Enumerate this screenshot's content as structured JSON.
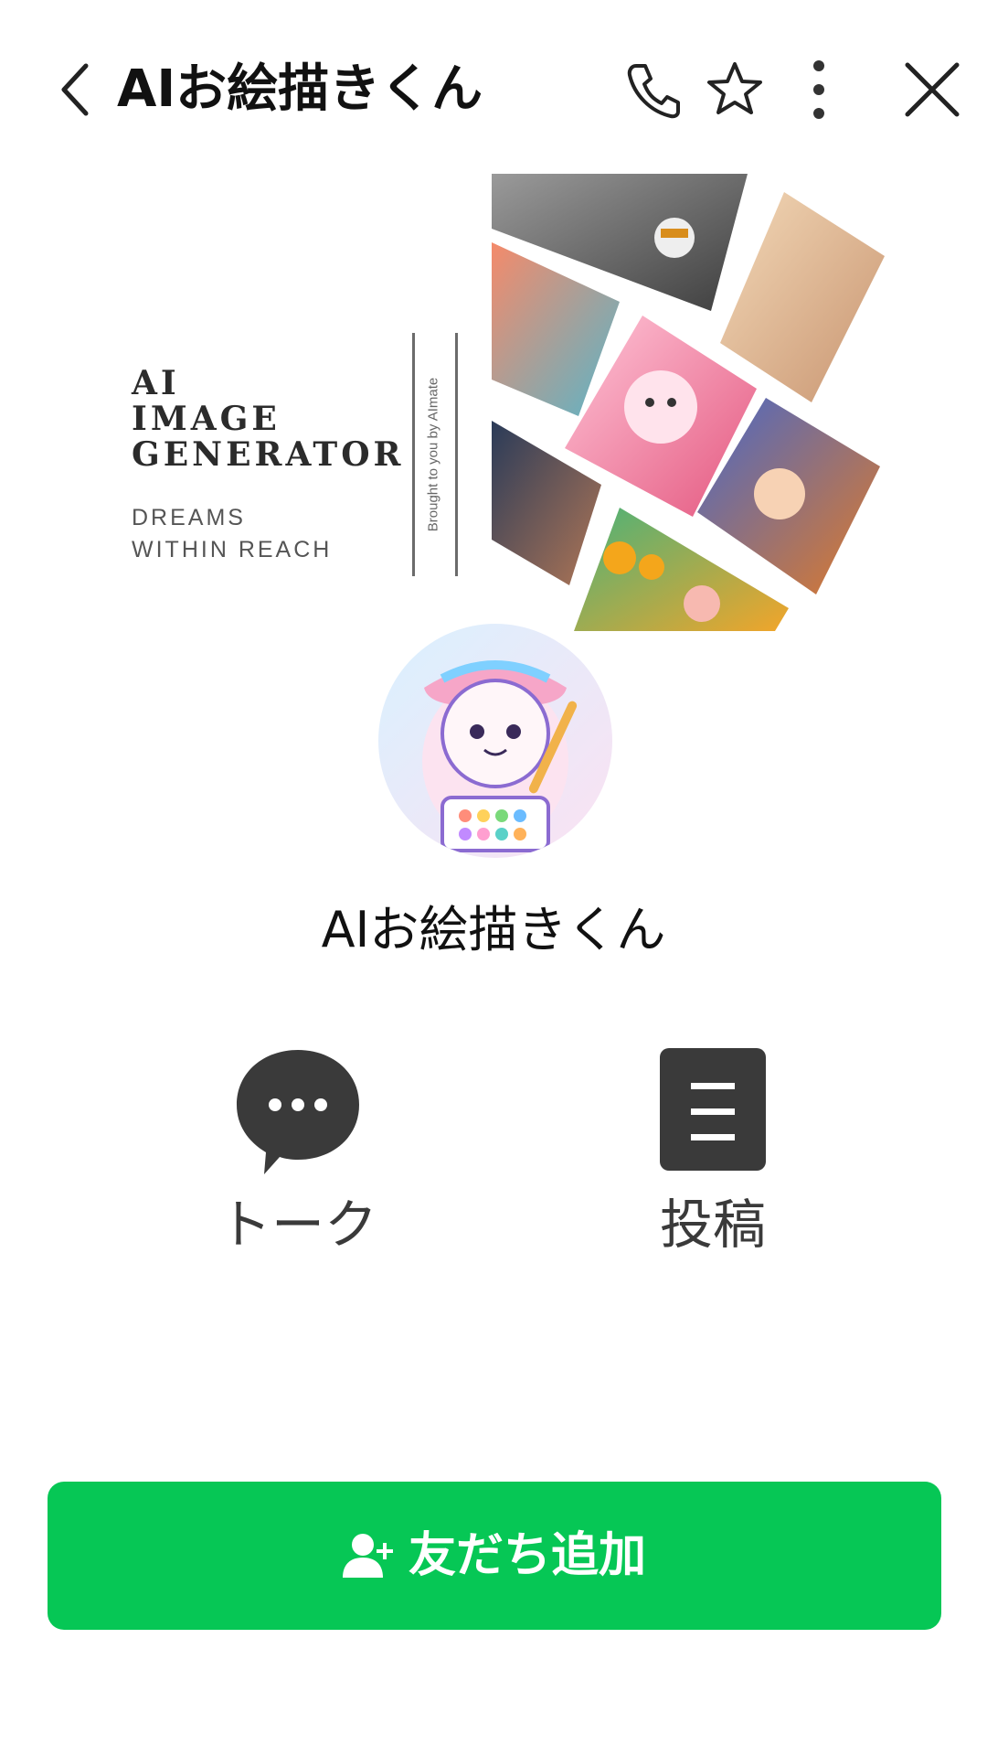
{
  "header": {
    "title": "AIお絵描きくん",
    "icons": [
      "back-arrow",
      "phone",
      "star",
      "more-vertical",
      "close"
    ]
  },
  "cover": {
    "headline": [
      "AI",
      "IMAGE",
      "GENERATOR"
    ],
    "tagline": [
      "DREAMS",
      "WITHIN REACH"
    ],
    "byline": "Brought to you by AImate"
  },
  "profile": {
    "name": "AIお絵描きくん"
  },
  "actions": [
    {
      "label": "トーク",
      "icon": "chat-bubble"
    },
    {
      "label": "投稿",
      "icon": "post-document"
    }
  ],
  "add_friend": {
    "label": "友だち追加",
    "icon": "add-person"
  },
  "colors": {
    "accent": "#06c755",
    "icon_dark": "#3a3a3a"
  }
}
